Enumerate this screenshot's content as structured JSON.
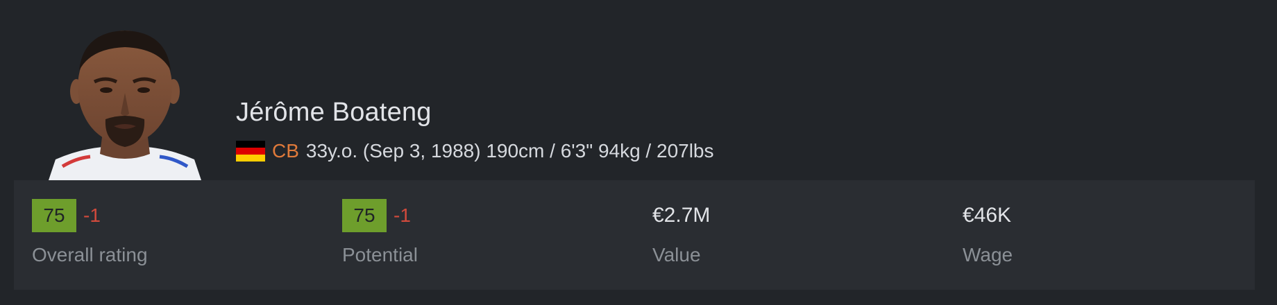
{
  "player": {
    "name": "Jérôme Boateng",
    "flag_icon": "germany-flag-icon",
    "position": "CB",
    "age": "33y.o.",
    "birthdate": "(Sep 3, 1988)",
    "height": "190cm / 6'3\"",
    "weight": "94kg / 207lbs",
    "position_color": "#e07a3a"
  },
  "stats": {
    "overall": {
      "value": "75",
      "delta": "-1",
      "label": "Overall rating"
    },
    "potential": {
      "value": "75",
      "delta": "-1",
      "label": "Potential"
    },
    "value": {
      "value": "€2.7M",
      "label": "Value"
    },
    "wage": {
      "value": "€46K",
      "label": "Wage"
    }
  },
  "colors": {
    "background": "#222529",
    "stats_panel": "#2a2d32",
    "rating_badge": "#6e9e2c",
    "delta_negative": "#d24a3c"
  }
}
